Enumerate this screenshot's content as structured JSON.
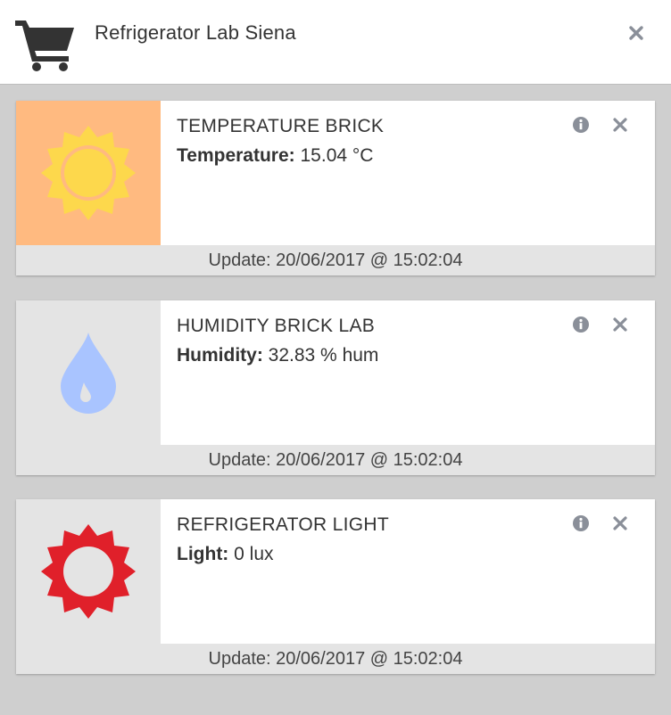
{
  "header": {
    "title": "Refrigerator Lab Siena",
    "icon": "shopping-cart-icon"
  },
  "cards": [
    {
      "name": "TEMPERATURE BRICK",
      "reading_label": "Temperature:",
      "reading_value": "15.04 °C",
      "update": "Update: 20/06/2017 @ 15:02:04",
      "icon": "sun-icon",
      "icon_bg": "#ffba80",
      "icon_color": "#fdd84c"
    },
    {
      "name": "HUMIDITY BRICK LAB",
      "reading_label": "Humidity:",
      "reading_value": "32.83 % hum",
      "update": "Update: 20/06/2017 @ 15:02:04",
      "icon": "water-drop-icon",
      "icon_bg": "#e4e4e4",
      "icon_color": "#a9c4ff"
    },
    {
      "name": "REFRIGERATOR LIGHT",
      "reading_label": "Light:",
      "reading_value": "0 lux",
      "update": "Update: 20/06/2017 @ 15:02:04",
      "icon": "sun-outline-icon",
      "icon_bg": "#e4e4e4",
      "icon_color": "#e0202a"
    }
  ]
}
